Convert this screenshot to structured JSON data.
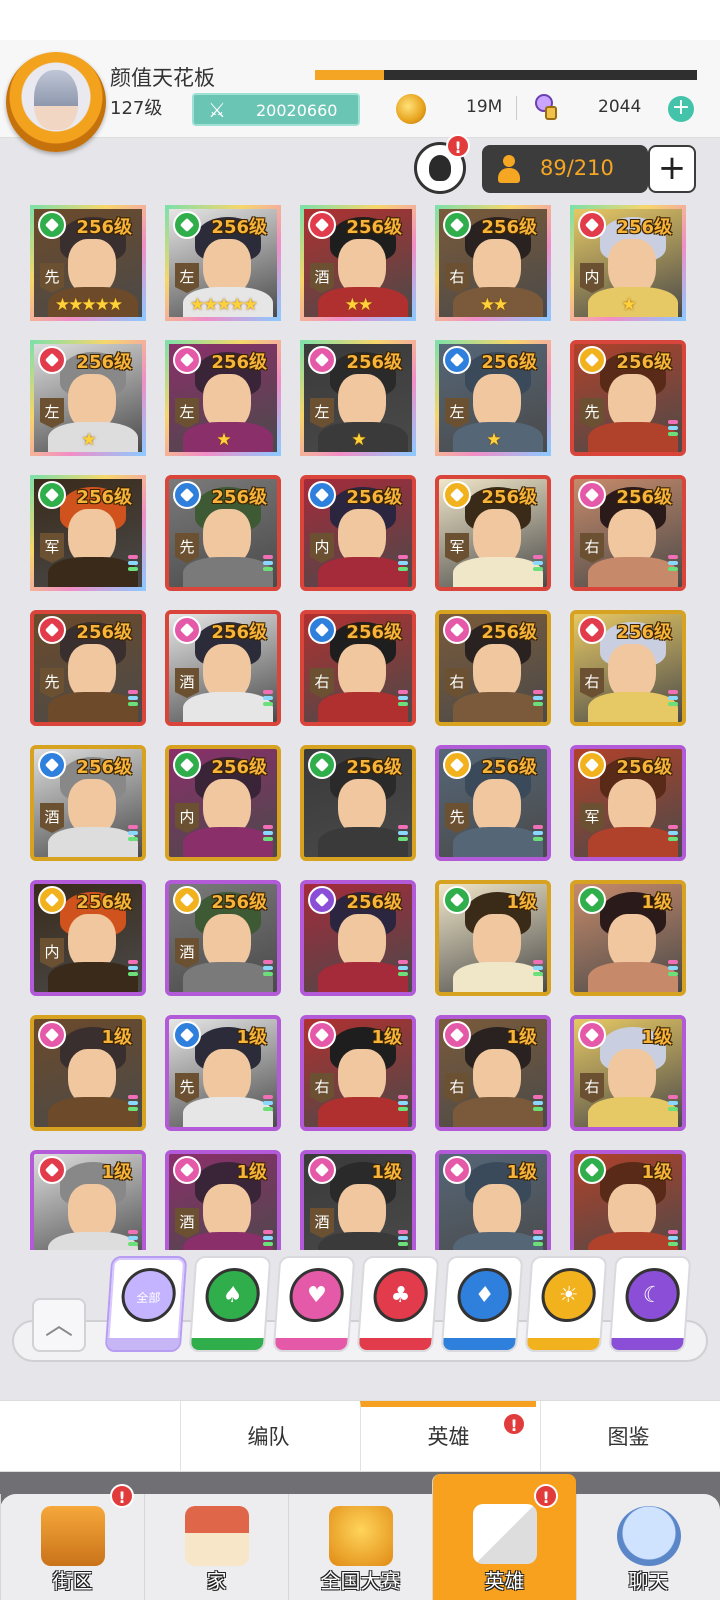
{
  "player": {
    "name": "颜值天花板",
    "level": "127级",
    "power": "20020660",
    "exp_fraction": 0.18,
    "coins": "19M",
    "gems": "2044"
  },
  "roster": {
    "alert": "!",
    "capacity": "89/210",
    "add_label": "+"
  },
  "colors": {
    "club": "#e23b4b",
    "heart": "#e55aa8",
    "spade": "#2fae4b",
    "diamond": "#2f7fdc",
    "sun": "#f1b21d",
    "moon": "#8a4fd6",
    "rarity_red": "#d9443b",
    "rarity_gold": "#d7a21f",
    "rarity_purple": "#b25ad8",
    "rarity_rainbow": "#6fd0a0"
  },
  "heroes": [
    {
      "level": "256级",
      "element": "spade",
      "position": "先",
      "stars": "★★★★★",
      "frame": "rainbow"
    },
    {
      "level": "256级",
      "element": "spade",
      "position": "左",
      "stars": "★★★★★",
      "frame": "rainbow"
    },
    {
      "level": "256级",
      "element": "club",
      "position": "酒",
      "stars": "★★",
      "frame": "rainbow"
    },
    {
      "level": "256级",
      "element": "spade",
      "position": "右",
      "stars": "★★",
      "frame": "rainbow"
    },
    {
      "level": "256级",
      "element": "club",
      "position": "内",
      "stars": "★",
      "frame": "rainbow"
    },
    {
      "level": "256级",
      "element": "club",
      "position": "左",
      "stars": "★",
      "frame": "rainbow"
    },
    {
      "level": "256级",
      "element": "heart",
      "position": "左",
      "stars": "★",
      "frame": "rainbow"
    },
    {
      "level": "256级",
      "element": "heart",
      "position": "左",
      "stars": "★",
      "frame": "rainbow"
    },
    {
      "level": "256级",
      "element": "diamond",
      "position": "左",
      "stars": "★",
      "frame": "rainbow"
    },
    {
      "level": "256级",
      "element": "sun",
      "position": "先",
      "stars": "",
      "frame": "red"
    },
    {
      "level": "256级",
      "element": "spade",
      "position": "军",
      "stars": "",
      "frame": "rainbow"
    },
    {
      "level": "256级",
      "element": "diamond",
      "position": "先",
      "stars": "",
      "frame": "red"
    },
    {
      "level": "256级",
      "element": "diamond",
      "position": "内",
      "stars": "",
      "frame": "red"
    },
    {
      "level": "256级",
      "element": "sun",
      "position": "军",
      "stars": "",
      "frame": "red"
    },
    {
      "level": "256级",
      "element": "heart",
      "position": "右",
      "stars": "",
      "frame": "red"
    },
    {
      "level": "256级",
      "element": "club",
      "position": "先",
      "stars": "",
      "frame": "red"
    },
    {
      "level": "256级",
      "element": "heart",
      "position": "酒",
      "stars": "",
      "frame": "red"
    },
    {
      "level": "256级",
      "element": "diamond",
      "position": "右",
      "stars": "",
      "frame": "red"
    },
    {
      "level": "256级",
      "element": "heart",
      "position": "右",
      "stars": "",
      "frame": "gold"
    },
    {
      "level": "256级",
      "element": "club",
      "position": "右",
      "stars": "",
      "frame": "gold"
    },
    {
      "level": "256级",
      "element": "diamond",
      "position": "酒",
      "stars": "",
      "frame": "gold"
    },
    {
      "level": "256级",
      "element": "spade",
      "position": "内",
      "stars": "",
      "frame": "gold"
    },
    {
      "level": "256级",
      "element": "spade",
      "position": "",
      "stars": "",
      "frame": "gold"
    },
    {
      "level": "256级",
      "element": "sun",
      "position": "先",
      "stars": "",
      "frame": "purple"
    },
    {
      "level": "256级",
      "element": "sun",
      "position": "军",
      "stars": "",
      "frame": "purple"
    },
    {
      "level": "256级",
      "element": "sun",
      "position": "内",
      "stars": "",
      "frame": "purple"
    },
    {
      "level": "256级",
      "element": "sun",
      "position": "酒",
      "stars": "",
      "frame": "purple"
    },
    {
      "level": "256级",
      "element": "moon",
      "position": "",
      "stars": "",
      "frame": "purple"
    },
    {
      "level": "1级",
      "element": "spade",
      "position": "",
      "stars": "",
      "frame": "gold"
    },
    {
      "level": "1级",
      "element": "spade",
      "position": "",
      "stars": "",
      "frame": "gold"
    },
    {
      "level": "1级",
      "element": "heart",
      "position": "",
      "stars": "",
      "frame": "gold"
    },
    {
      "level": "1级",
      "element": "diamond",
      "position": "先",
      "stars": "",
      "frame": "purple"
    },
    {
      "level": "1级",
      "element": "heart",
      "position": "右",
      "stars": "",
      "frame": "purple"
    },
    {
      "level": "1级",
      "element": "heart",
      "position": "右",
      "stars": "",
      "frame": "purple"
    },
    {
      "level": "1级",
      "element": "heart",
      "position": "右",
      "stars": "",
      "frame": "purple"
    },
    {
      "level": "1级",
      "element": "club",
      "position": "",
      "stars": "",
      "frame": "purple"
    },
    {
      "level": "1级",
      "element": "heart",
      "position": "酒",
      "stars": "",
      "frame": "purple"
    },
    {
      "level": "1级",
      "element": "heart",
      "position": "酒",
      "stars": "",
      "frame": "purple"
    },
    {
      "level": "1级",
      "element": "heart",
      "position": "",
      "stars": "",
      "frame": "purple"
    },
    {
      "level": "1级",
      "element": "spade",
      "position": "",
      "stars": "",
      "frame": "purple"
    }
  ],
  "filters": {
    "all_label": "全部",
    "items": [
      {
        "icon": "all-filter-icon",
        "symbol": "",
        "color": "#c4b3ff"
      },
      {
        "icon": "spade-filter-icon",
        "symbol": "♠",
        "color": "#2fae4b"
      },
      {
        "icon": "heart-filter-icon",
        "symbol": "♥",
        "color": "#e55aa8"
      },
      {
        "icon": "club-filter-icon",
        "symbol": "♣",
        "color": "#e23b4b"
      },
      {
        "icon": "diamond-filter-icon",
        "symbol": "♦",
        "color": "#2f7fdc"
      },
      {
        "icon": "sun-filter-icon",
        "symbol": "☀",
        "color": "#f1b21d"
      },
      {
        "icon": "moon-filter-icon",
        "symbol": "☾",
        "color": "#8a4fd6"
      }
    ]
  },
  "subtabs": {
    "formation": "编队",
    "heroes": "英雄",
    "codex": "图鉴"
  },
  "nav": {
    "street": "街区",
    "home": "家",
    "tournament": "全国大赛",
    "heroes": "英雄",
    "chat": "聊天"
  }
}
